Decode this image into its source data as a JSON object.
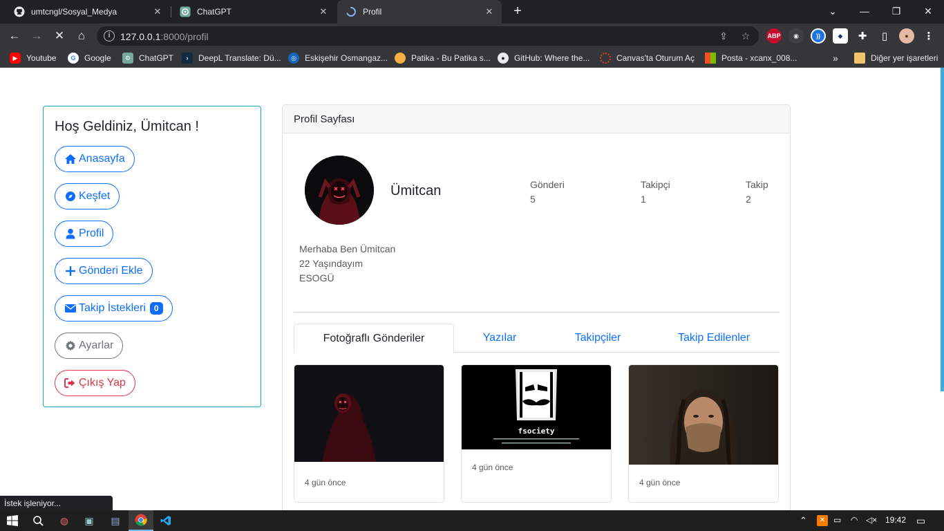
{
  "browser": {
    "tabs": [
      {
        "title": "umtcngl/Sosyal_Medya",
        "icon": "github-icon"
      },
      {
        "title": "ChatGPT",
        "icon": "chatgpt-icon"
      },
      {
        "title": "Profil",
        "icon": "loading-icon"
      }
    ],
    "url_host": "127.0.0.1",
    "url_rest": ":8000/profil",
    "bookmarks": [
      {
        "label": "Youtube",
        "color": "#ff0000"
      },
      {
        "label": "Google",
        "color": "#4285f4"
      },
      {
        "label": "ChatGPT",
        "color": "#74aa9c"
      },
      {
        "label": "DeepL Translate: Dü...",
        "color": "#0f2b46"
      },
      {
        "label": "Eskişehir Osmangaz...",
        "color": "#1565c0"
      },
      {
        "label": "Patika - Bu Patika s...",
        "color": "#f5b041"
      },
      {
        "label": "GitHub: Where the...",
        "color": "#ffffff"
      },
      {
        "label": "Canvas'ta Oturum Aç",
        "color": "#e13c2e"
      },
      {
        "label": "Posta - xcanx_008...",
        "color": "#f25022"
      }
    ],
    "other_bookmarks": "Diğer yer işaretleri",
    "status_text": "İstek işleniyor..."
  },
  "sidebar": {
    "greeting": "Hoş Geldiniz, Ümitcan !",
    "items": [
      {
        "label": "Anasayfa",
        "icon": "home-icon"
      },
      {
        "label": "Keşfet",
        "icon": "compass-icon"
      },
      {
        "label": "Profil",
        "icon": "user-icon"
      },
      {
        "label": "Gönderi Ekle",
        "icon": "plus-icon"
      },
      {
        "label": "Takip İstekleri",
        "icon": "envelope-icon",
        "badge": "0"
      },
      {
        "label": "Ayarlar",
        "icon": "gear-icon"
      },
      {
        "label": "Çıkış Yap",
        "icon": "sign-out-icon"
      }
    ]
  },
  "profile": {
    "header": "Profil Sayfası",
    "username": "Ümitcan",
    "stats": [
      {
        "label": "Gönderi",
        "value": "5"
      },
      {
        "label": "Takipçi",
        "value": "1"
      },
      {
        "label": "Takip",
        "value": "2"
      }
    ],
    "bio": [
      "Merhaba Ben Ümitcan",
      "22 Yaşındayım",
      "ESOGÜ"
    ],
    "tabs": [
      "Fotoğraflı Gönderiler",
      "Yazılar",
      "Takipçiler",
      "Takip Edilenler"
    ],
    "posts": [
      {
        "time": "4 gün önce"
      },
      {
        "time": "4 gün önce",
        "image_text": "fsociety"
      },
      {
        "time": "4 gün önce"
      }
    ]
  },
  "taskbar": {
    "clock": "19:42"
  },
  "colors": {
    "primary": "#0d6efd",
    "info_border": "#17a2b8",
    "secondary": "#6c757d",
    "danger": "#dc3545"
  }
}
